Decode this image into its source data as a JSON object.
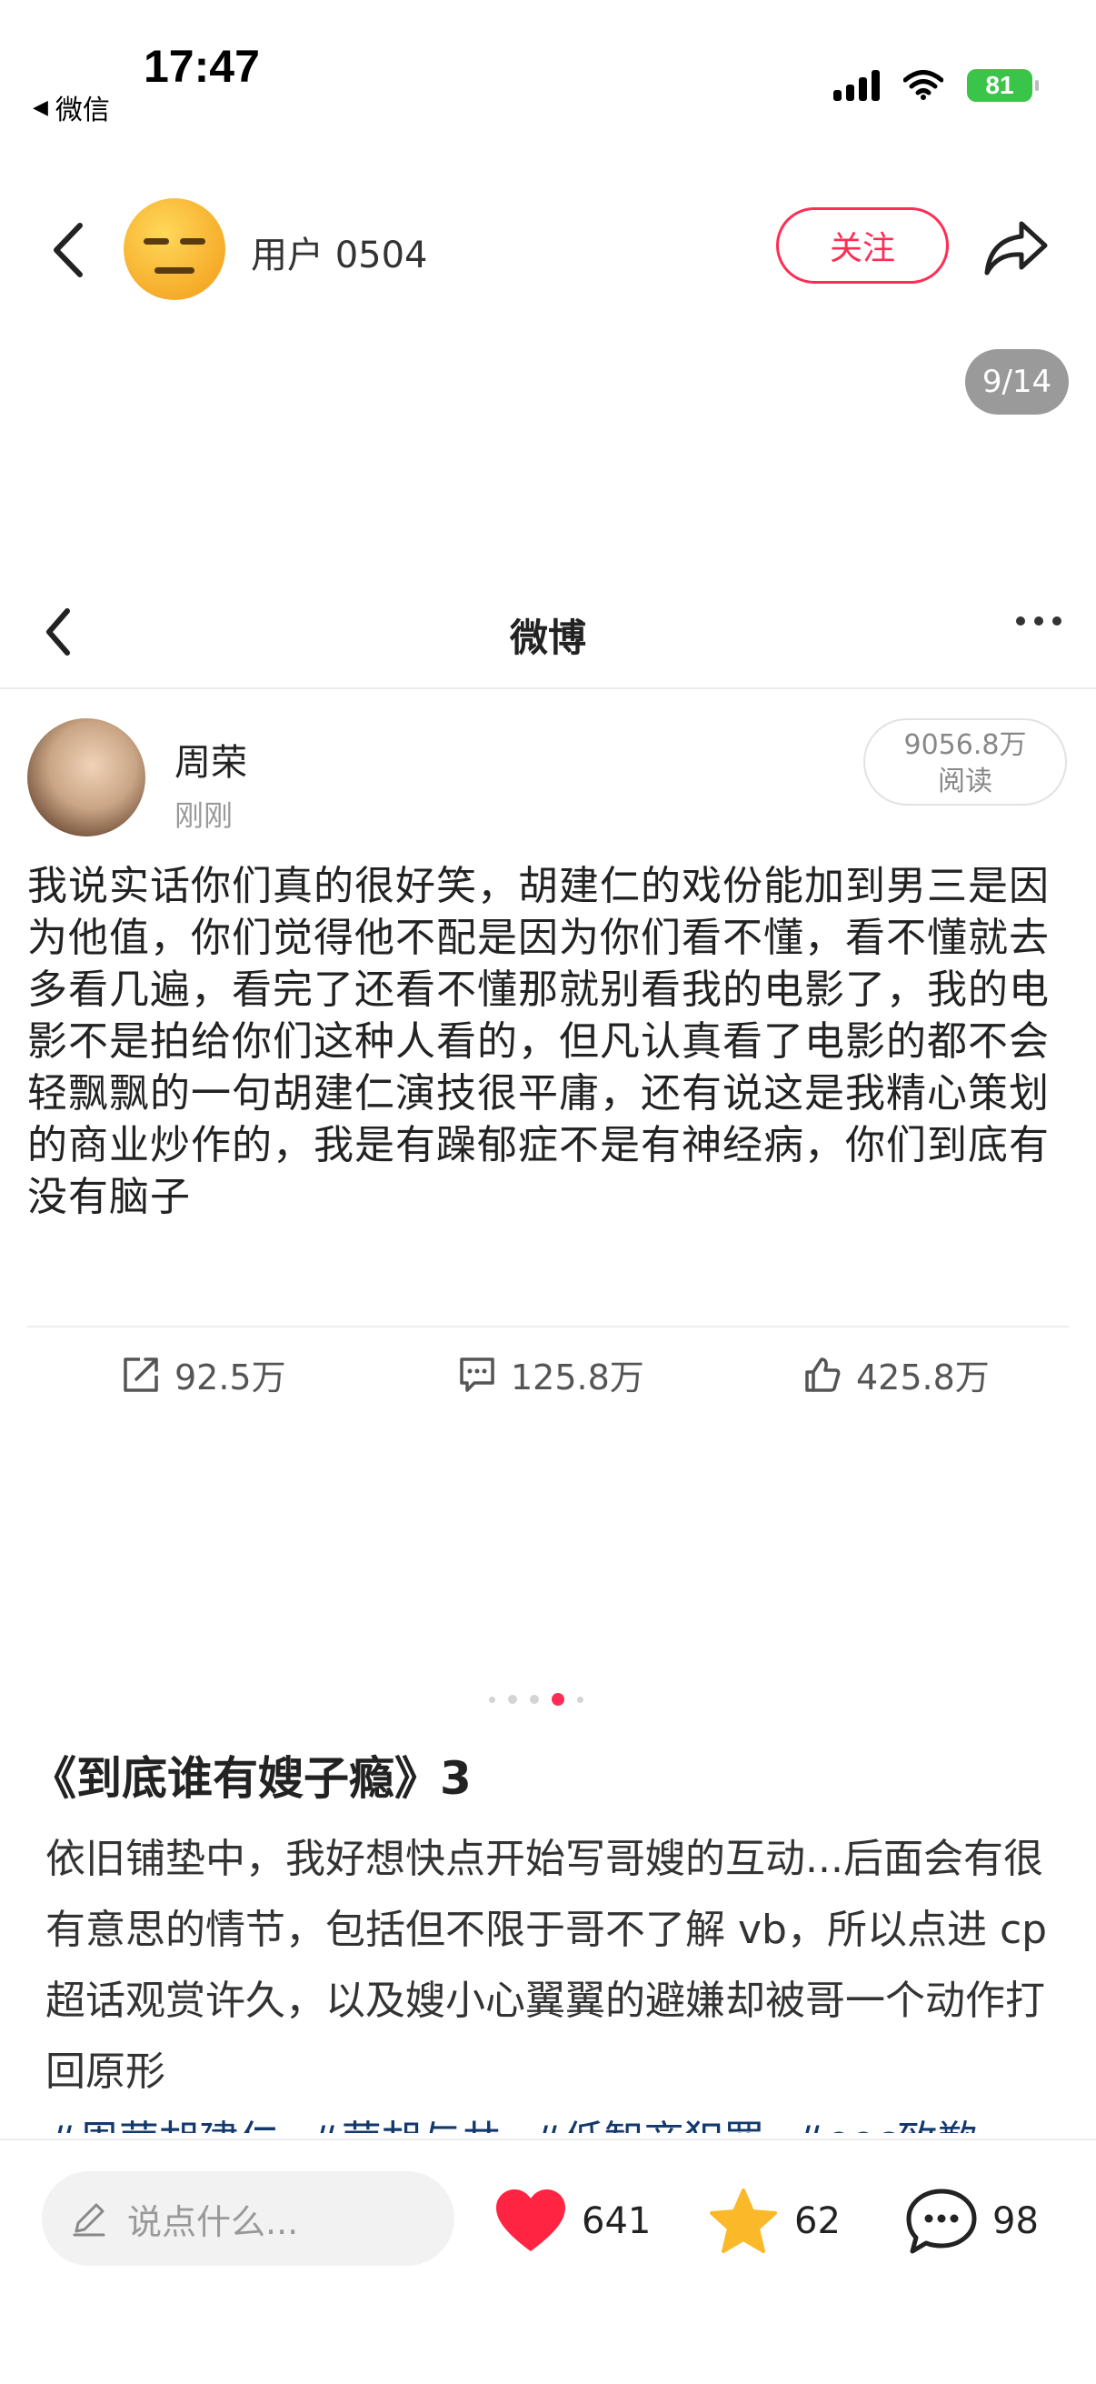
{
  "status_bar": {
    "time": "17:47",
    "back_app": "微信",
    "battery": "81"
  },
  "header": {
    "username": "用户 0504",
    "follow_label": "关注",
    "page_counter": "9/14"
  },
  "weibo": {
    "nav_title": "微博",
    "author_name": "周荣",
    "post_time": "刚刚",
    "reads_value": "9056.8万",
    "reads_label": "阅读",
    "body": "我说实话你们真的很好笑，胡建仁的戏份能加到男三是因为他值，你们觉得他不配是因为你们看不懂，看不懂就去多看几遍，看完了还看不懂那就别看我的电影了，我的电影不是拍给你们这种人看的，但凡认真看了电影的都不会轻飘飘的一句胡建仁演技很平庸，还有说这是我精心策划的商业炒作的，我是有躁郁症不是有神经病，你们到底有没有脑子",
    "reposts": "92.5万",
    "comments": "125.8万",
    "likes": "425.8万"
  },
  "carousel": {
    "total_dots": 5,
    "active_index": 3
  },
  "note": {
    "title": "《到底谁有嫂子瘾》3",
    "body": "依旧铺垫中，我好想快点开始写哥嫂的互动...后面会有很有意思的情节，包括但不限于哥不了解 vb，所以点进 cp 超话观赏许久，以及嫂小心翼翼的避嫌却被哥一个动作打回原形",
    "tags": [
      "#周荣胡建仁",
      "#荣胡与共",
      "#低智商犯罪",
      "#ooc致歉"
    ]
  },
  "bottom_bar": {
    "comment_placeholder": "说点什么...",
    "likes": "641",
    "favorites": "62",
    "comments": "98",
    "like_color": "#ff2442",
    "favorite_color": "#fbb829"
  },
  "icons": {
    "back": "chevron-left-icon",
    "share": "share-arrow-icon",
    "more": "more-dots-icon",
    "repost": "repost-icon",
    "comment": "comment-icon",
    "like": "thumbs-up-icon",
    "pen": "pen-icon",
    "heart": "heart-icon",
    "star": "star-icon",
    "chat": "chat-bubble-icon"
  }
}
